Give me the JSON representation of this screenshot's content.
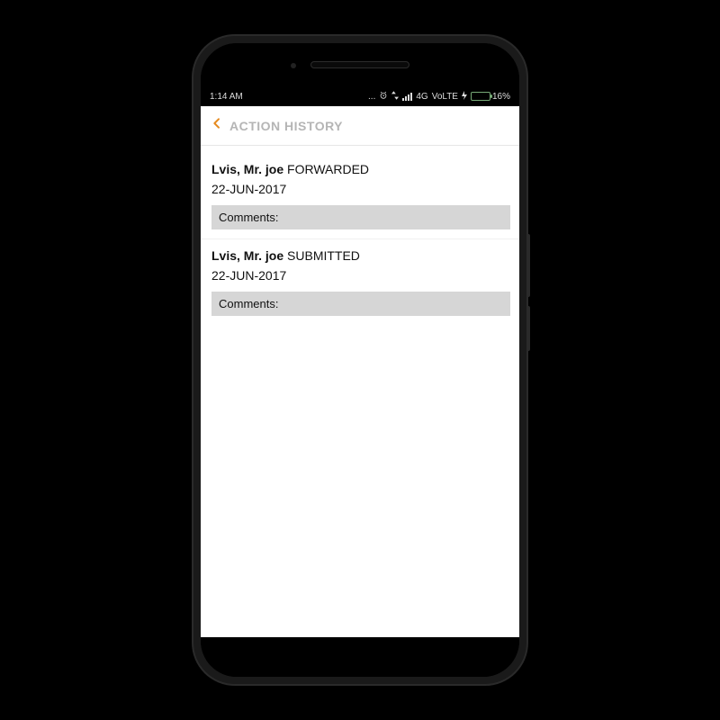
{
  "status_bar": {
    "time": "1:14 AM",
    "dots": "...",
    "network_label": "4G",
    "volte_label": "VoLTE",
    "battery_text": "16%"
  },
  "header": {
    "title": "ACTION HISTORY"
  },
  "items": [
    {
      "who": "Lvis, Mr. joe",
      "action": "FORWARDED",
      "date": "22-JUN-2017",
      "comments_label": "Comments:"
    },
    {
      "who": "Lvis, Mr. joe",
      "action": "SUBMITTED",
      "date": "22-JUN-2017",
      "comments_label": "Comments:"
    }
  ]
}
